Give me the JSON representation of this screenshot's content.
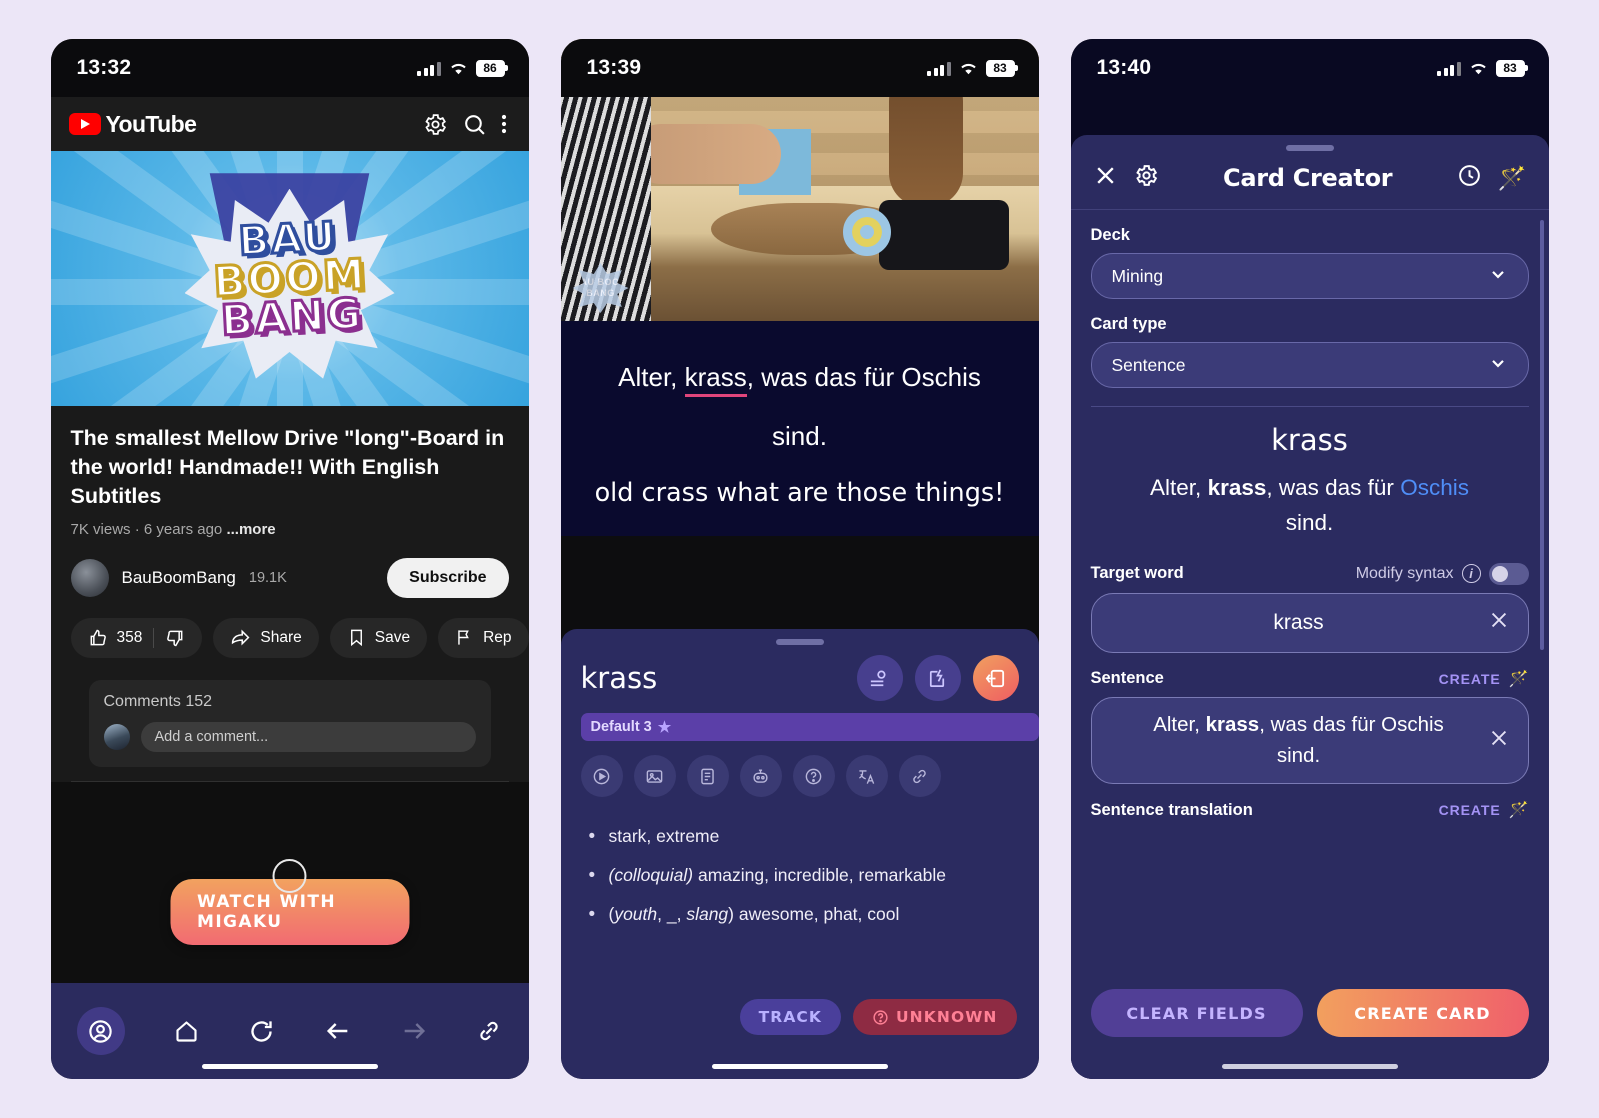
{
  "panel1": {
    "status": {
      "time": "13:32",
      "battery": "86"
    },
    "appbar": {
      "brand": "YouTube",
      "settings_icon": "gear-icon",
      "search_icon": "search-icon",
      "more_icon": "more-vertical-icon"
    },
    "thumbnail": {
      "logo_line1": "BAU",
      "logo_line2": "BOOM",
      "logo_line3": "BANG"
    },
    "video": {
      "title": "The smallest Mellow Drive \"long\"-Board in the world! Handmade!! With English Subtitles",
      "views": "7K views",
      "age": "6 years ago",
      "more": "...more",
      "channel": "BauBoomBang",
      "subscribers": "19.1K",
      "subscribe_label": "Subscribe"
    },
    "actions": {
      "likes": "358",
      "share": "Share",
      "save": "Save",
      "report": "Rep"
    },
    "comments": {
      "label": "Comments",
      "count": "152",
      "placeholder": "Add a comment..."
    },
    "migaku_button": "WATCH WITH MIGAKU",
    "navbar": [
      "account-icon",
      "home-icon",
      "reload-icon",
      "back-arrow-icon",
      "forward-arrow-icon",
      "link-icon"
    ]
  },
  "panel2": {
    "status": {
      "time": "13:39",
      "battery": "83"
    },
    "video_watermark": "BAU BOOM BANG",
    "subtitle": {
      "before": "Alter, ",
      "target": "krass",
      "after": ", was das für Oschis",
      "line2": "sind.",
      "translation": "old crass what are those things!"
    },
    "dictionary": {
      "word": "krass",
      "badge": "Default 3",
      "icons": [
        "play-circle-icon",
        "image-icon",
        "document-icon",
        "robot-icon",
        "question-circle-icon",
        "translate-icon",
        "link-icon"
      ],
      "header_icons": [
        "search-person-icon",
        "edit-card-icon",
        "export-card-icon"
      ],
      "definitions": [
        "stark, extreme",
        "(colloquial) amazing, incredible, remarkable",
        "(youth, _, slang) awesome, phat, cool"
      ],
      "track_label": "TRACK",
      "unknown_label": "UNKNOWN"
    }
  },
  "panel3": {
    "status": {
      "time": "13:40",
      "battery": "83"
    },
    "header": {
      "title": "Card Creator",
      "close_icon": "close-icon",
      "settings_icon": "gear-icon",
      "history_icon": "clock-icon",
      "magic_icon": "magic-wand-icon"
    },
    "deck": {
      "label": "Deck",
      "value": "Mining"
    },
    "card_type": {
      "label": "Card type",
      "value": "Sentence"
    },
    "preview": {
      "word": "krass",
      "sentence_before": "Alter, ",
      "sentence_bold": "krass",
      "sentence_mid": ", was das für ",
      "sentence_highlight": "Oschis",
      "sentence_line2": "sind."
    },
    "target_word": {
      "label": "Target word",
      "modify_syntax": "Modify syntax",
      "value": "krass",
      "clear_icon": "close-icon"
    },
    "sentence": {
      "label": "Sentence",
      "create": "CREATE",
      "value_before": "Alter, ",
      "value_bold": "krass",
      "value_after": ", was das für Oschis",
      "value_line2": "sind.",
      "clear_icon": "close-icon"
    },
    "sentence_translation": {
      "label": "Sentence translation",
      "create": "CREATE"
    },
    "actions": {
      "clear": "CLEAR FIELDS",
      "create": "CREATE CARD"
    }
  }
}
